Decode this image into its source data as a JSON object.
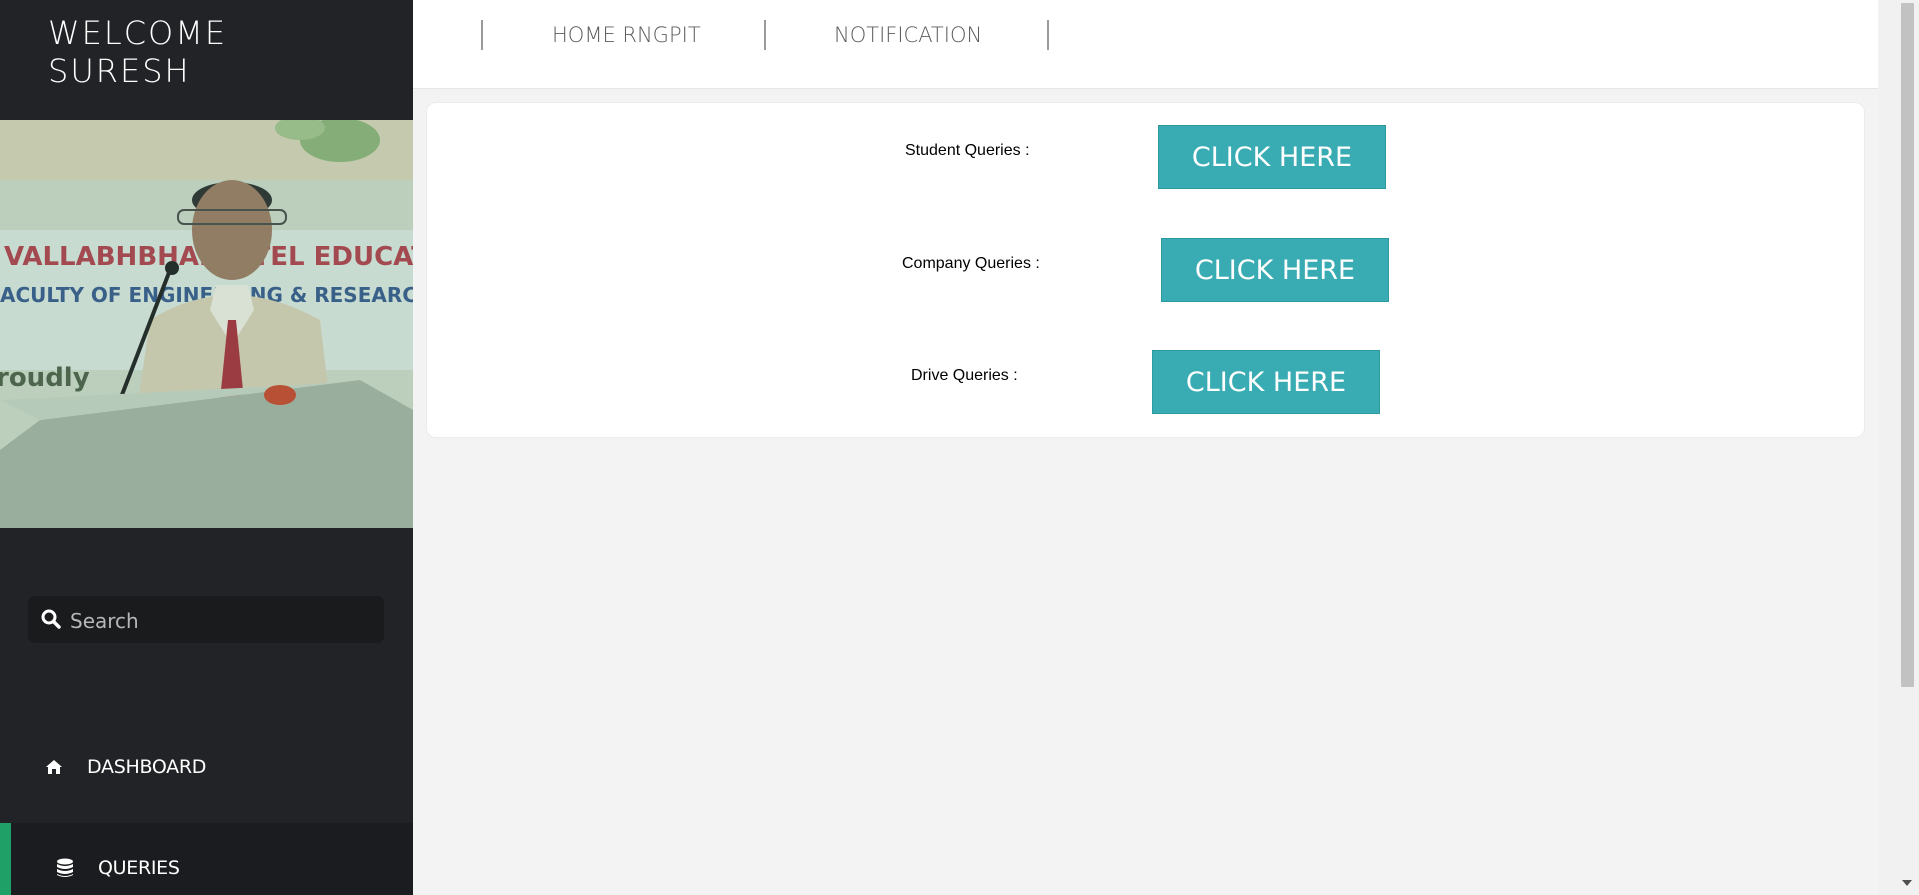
{
  "sidebar": {
    "welcome_line1": "WELCOME",
    "welcome_line2": "SURESH",
    "profile_image_icon": "speaker-photo",
    "search": {
      "placeholder": "Search",
      "icon": "search-icon"
    },
    "nav": [
      {
        "label": "DASHBOARD",
        "icon": "home-icon",
        "active": false
      },
      {
        "label": "QUERIES",
        "icon": "database-icon",
        "active": true
      }
    ]
  },
  "topbar": {
    "links": [
      "HOME RNGPIT",
      "NOTIFICATION"
    ]
  },
  "queries": [
    {
      "label": "Student Queries :",
      "button": "CLICK HERE"
    },
    {
      "label": "Company Queries :",
      "button": "CLICK HERE"
    },
    {
      "label": "Drive Queries :",
      "button": "CLICK HERE"
    }
  ],
  "colors": {
    "sidebar_bg": "#222326",
    "accent_button": "#39acb3",
    "active_marker": "#1fa067",
    "content_bg": "#f3f3f3"
  }
}
